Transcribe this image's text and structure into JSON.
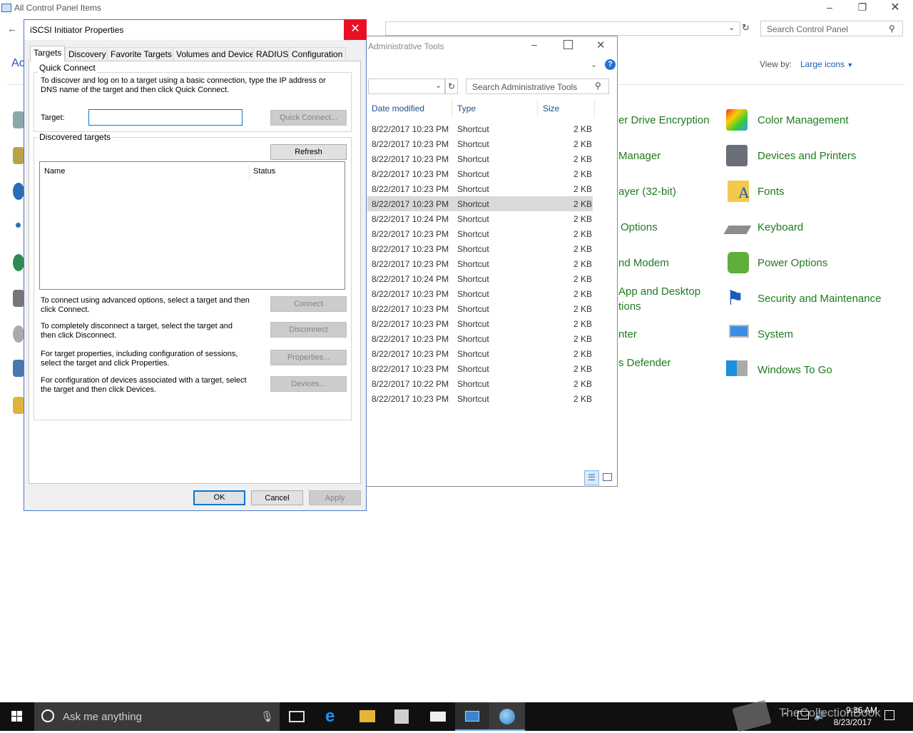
{
  "control_panel": {
    "title": "All Control Panel Items",
    "search_placeholder": "Search Control Panel",
    "view_by_label": "View by:",
    "view_by_value": "Large icons",
    "partial_heading": "Ac",
    "middle_items": [
      "er Drive Encryption",
      "Manager",
      "ayer (32-bit)",
      "Options",
      "nd Modem",
      "App and Desktop",
      "tions",
      "nter",
      "s Defender"
    ],
    "right_items": [
      {
        "label": "Color Management",
        "icon": "color-management-icon"
      },
      {
        "label": "Devices and Printers",
        "icon": "devices-printers-icon"
      },
      {
        "label": "Fonts",
        "icon": "fonts-icon"
      },
      {
        "label": "Keyboard",
        "icon": "keyboard-icon"
      },
      {
        "label": "Power Options",
        "icon": "power-options-icon"
      },
      {
        "label": "Security and Maintenance",
        "icon": "security-maintenance-icon"
      },
      {
        "label": "System",
        "icon": "system-icon"
      },
      {
        "label": "Windows To Go",
        "icon": "windows-to-go-icon"
      }
    ]
  },
  "admin_tools": {
    "title": "Administrative Tools",
    "search_placeholder": "Search Administrative Tools",
    "columns": [
      "Date modified",
      "Type",
      "Size"
    ],
    "rows": [
      [
        "8/22/2017 10:23 PM",
        "Shortcut",
        "2 KB"
      ],
      [
        "8/22/2017 10:23 PM",
        "Shortcut",
        "2 KB"
      ],
      [
        "8/22/2017 10:23 PM",
        "Shortcut",
        "2 KB"
      ],
      [
        "8/22/2017 10:23 PM",
        "Shortcut",
        "2 KB"
      ],
      [
        "8/22/2017 10:23 PM",
        "Shortcut",
        "2 KB"
      ],
      [
        "8/22/2017 10:23 PM",
        "Shortcut",
        "2 KB"
      ],
      [
        "8/22/2017 10:24 PM",
        "Shortcut",
        "2 KB"
      ],
      [
        "8/22/2017 10:23 PM",
        "Shortcut",
        "2 KB"
      ],
      [
        "8/22/2017 10:23 PM",
        "Shortcut",
        "2 KB"
      ],
      [
        "8/22/2017 10:23 PM",
        "Shortcut",
        "2 KB"
      ],
      [
        "8/22/2017 10:24 PM",
        "Shortcut",
        "2 KB"
      ],
      [
        "8/22/2017 10:23 PM",
        "Shortcut",
        "2 KB"
      ],
      [
        "8/22/2017 10:23 PM",
        "Shortcut",
        "2 KB"
      ],
      [
        "8/22/2017 10:23 PM",
        "Shortcut",
        "2 KB"
      ],
      [
        "8/22/2017 10:23 PM",
        "Shortcut",
        "2 KB"
      ],
      [
        "8/22/2017 10:23 PM",
        "Shortcut",
        "2 KB"
      ],
      [
        "8/22/2017 10:23 PM",
        "Shortcut",
        "2 KB"
      ],
      [
        "8/22/2017 10:22 PM",
        "Shortcut",
        "2 KB"
      ],
      [
        "8/22/2017 10:23 PM",
        "Shortcut",
        "2 KB"
      ]
    ]
  },
  "dialog": {
    "title": "iSCSI Initiator Properties",
    "close": "✕",
    "tabs": [
      "Targets",
      "Discovery",
      "Favorite Targets",
      "Volumes and Devices",
      "RADIUS",
      "Configuration"
    ],
    "quick_connect": {
      "group_title": "Quick Connect",
      "description": "To discover and log on to a target using a basic connection, type the IP address or DNS name of the target and then click Quick Connect.",
      "target_label": "Target:",
      "target_value": "",
      "button": "Quick Connect..."
    },
    "discovered": {
      "group_title": "Discovered targets",
      "refresh": "Refresh",
      "col_name": "Name",
      "col_status": "Status",
      "connect_text": "To connect using advanced options, select a target and then click Connect.",
      "connect": "Connect",
      "disconnect_text": "To completely disconnect a target, select the target and then click Disconnect.",
      "disconnect": "Disconnect",
      "properties_text": "For target properties, including configuration of sessions, select the target and click Properties.",
      "properties": "Properties...",
      "devices_text": "For configuration of devices associated with a target, select the target and then click Devices.",
      "devices": "Devices..."
    },
    "ok": "OK",
    "cancel": "Cancel",
    "apply": "Apply"
  },
  "taskbar": {
    "search_placeholder": "Ask me anything",
    "time": "9:36 AM",
    "date": "8/23/2017",
    "watermark": "TheCollectionBook"
  },
  "colors": {
    "accent": "#0078d7",
    "link_green": "#1f7a1f",
    "close_red": "#e81123",
    "taskbar": "#101010"
  }
}
